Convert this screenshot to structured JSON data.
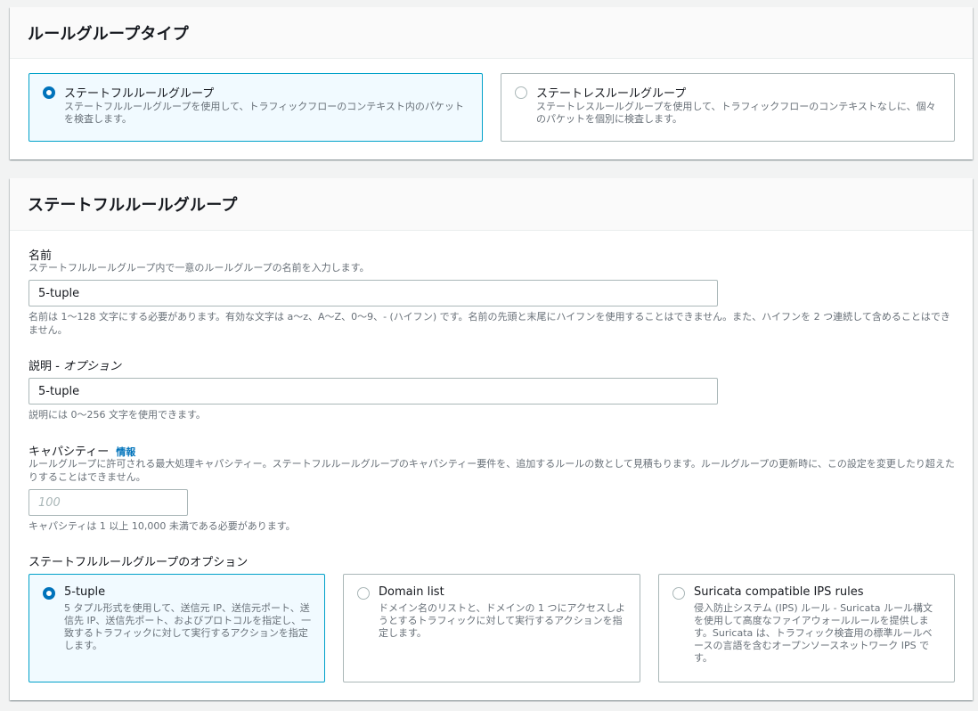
{
  "rule_group_type": {
    "title": "ルールグループタイプ",
    "options": [
      {
        "label": "ステートフルルールグループ",
        "description": "ステートフルルールグループを使用して、トラフィックフローのコンテキスト内のパケットを検査します。",
        "selected": true
      },
      {
        "label": "ステートレスルールグループ",
        "description": "ステートレスルールグループを使用して、トラフィックフローのコンテキストなしに、個々のパケットを個別に検査します。",
        "selected": false
      }
    ]
  },
  "stateful_rule_group": {
    "title": "ステートフルルールグループ",
    "name": {
      "label": "名前",
      "description": "ステートフルルールグループ内で一意のルールグループの名前を入力します。",
      "value": "5-tuple",
      "constraint": "名前は 1〜128 文字にする必要があります。有効な文字は a〜z、A〜Z、0〜9、- (ハイフン) です。名前の先頭と末尾にハイフンを使用することはできません。また、ハイフンを 2 つ連続して含めることはできません。"
    },
    "description_field": {
      "label": "説明",
      "label_suffix": " - オプション",
      "value": "5-tuple",
      "constraint": "説明には 0〜256 文字を使用できます。"
    },
    "capacity": {
      "label": "キャパシティー",
      "info_link": "情報",
      "description": "ルールグループに許可される最大処理キャパシティー。ステートフルルールグループのキャパシティー要件を、追加するルールの数として見積もります。ルールグループの更新時に、この設定を変更したり超えたりすることはできません。",
      "placeholder": "100",
      "constraint": "キャパシティは 1 以上 10,000 未満である必要があります。"
    },
    "options": {
      "label": "ステートフルルールグループのオプション",
      "items": [
        {
          "label": "5-tuple",
          "description": "5 タプル形式を使用して、送信元 IP、送信元ポート、送信先 IP、送信先ポート、およびプロトコルを指定し、一致するトラフィックに対して実行するアクションを指定します。",
          "selected": true
        },
        {
          "label": "Domain list",
          "description": "ドメイン名のリストと、ドメインの 1 つにアクセスしようとするトラフィックに対して実行するアクションを指定します。",
          "selected": false
        },
        {
          "label": "Suricata compatible IPS rules",
          "description": "侵入防止システム (IPS) ルール - Suricata ルール構文を使用して高度なファイアウォールルールを提供します。Suricata は、トラフィック検査用の標準ルールベースの言語を含むオープンソースネットワーク IPS です。",
          "selected": false
        }
      ]
    }
  },
  "colors": {
    "accent": "#0073bb",
    "selected_border": "#00a1c9",
    "selected_bg": "#f1faff",
    "border": "#aab7b8",
    "muted_text": "#687078"
  }
}
